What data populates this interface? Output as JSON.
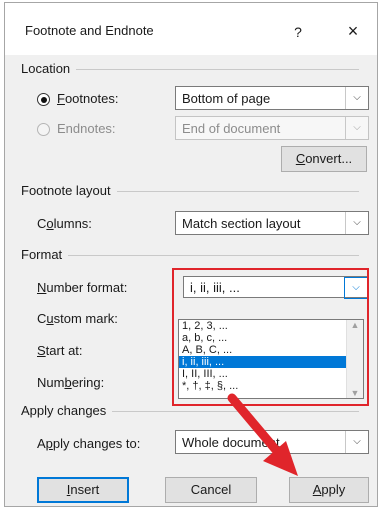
{
  "dialog": {
    "title": "Footnote and Endnote",
    "help_label": "?",
    "close_label": "×"
  },
  "location": {
    "section_label": "Location",
    "footnotes": {
      "label_pre": "",
      "label_u": "F",
      "label_post": "ootnotes:",
      "value": "Bottom of page",
      "checked": true
    },
    "endnotes": {
      "label": "Endnotes:",
      "value": "End of document",
      "checked": false
    },
    "convert_pre": "",
    "convert_u": "C",
    "convert_post": "onvert..."
  },
  "layout": {
    "section_label": "Footnote layout",
    "columns_pre": "C",
    "columns_u": "o",
    "columns_post": "lumns:",
    "columns_value": "Match section layout"
  },
  "format": {
    "section_label": "Format",
    "number_format_pre": "",
    "number_format_u": "N",
    "number_format_post": "umber format:",
    "number_format_value": "i, ii, iii, ...",
    "custom_mark_pre": "C",
    "custom_mark_u": "u",
    "custom_mark_post": "stom mark:",
    "start_at_pre": "",
    "start_at_u": "S",
    "start_at_post": "tart at:",
    "numbering_pre": "Num",
    "numbering_u": "b",
    "numbering_post": "ering:",
    "options": [
      "1, 2, 3, ...",
      "a, b, c, ...",
      "A, B, C, ...",
      "i, ii, iii, ...",
      "I, II, III, ...",
      "*, †, ‡, §, ..."
    ],
    "selected_index": 3
  },
  "apply": {
    "section_label": "Apply changes",
    "apply_to_pre": "A",
    "apply_to_u": "p",
    "apply_to_post": "ply changes to:",
    "apply_to_value": "Whole document"
  },
  "buttons": {
    "insert_pre": "",
    "insert_u": "I",
    "insert_post": "nsert",
    "cancel": "Cancel",
    "apply_pre": "",
    "apply_u": "A",
    "apply_post": "pply"
  },
  "colors": {
    "highlight": "#e0252b",
    "selection": "#0078d7"
  }
}
